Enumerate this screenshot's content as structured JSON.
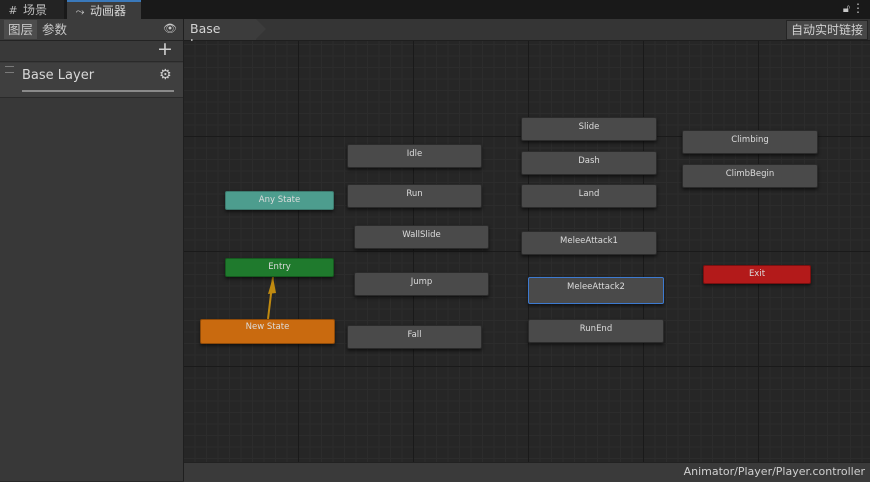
{
  "tabs": [
    {
      "label": "场景",
      "icon": "grid-icon"
    },
    {
      "label": "动画器",
      "icon": "animator-icon"
    }
  ],
  "left_panel": {
    "layers_tab": "图层",
    "parameters_tab": "参数",
    "layer_name": "Base Layer"
  },
  "breadcrumb": "Base Layer",
  "auto_live_link": "自动实时链接",
  "nodes": {
    "any_state": "Any State",
    "entry": "Entry",
    "new_state": "New State",
    "idle": "Idle",
    "run": "Run",
    "wallslide": "WallSlide",
    "jump": "Jump",
    "fall": "Fall",
    "slide": "Slide",
    "dash": "Dash",
    "land": "Land",
    "melee1": "MeleeAttack1",
    "melee2": "MeleeAttack2",
    "runend": "RunEnd",
    "climbing": "Climbing",
    "climbbegin": "ClimbBegin",
    "exit": "Exit"
  },
  "colors": {
    "any_state": "#4d9d8e",
    "entry": "#1f7a2d",
    "default_state": "#c96a0f",
    "exit": "#b31a1a",
    "state": "#4a4a4a",
    "selection": "#3d7ad0",
    "transition": "#c08a10"
  },
  "status_path": "Animator/Player/Player.controller"
}
